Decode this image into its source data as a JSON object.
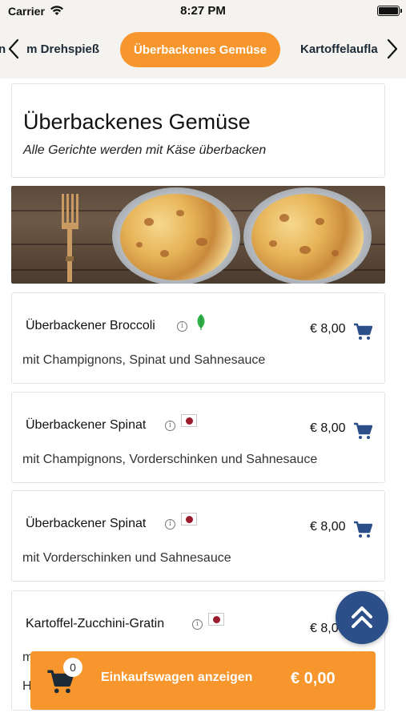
{
  "status_bar": {
    "carrier": "Carrier",
    "time": "8:27 PM"
  },
  "categories": {
    "left": "m Drehspieß",
    "left_prefix": "n",
    "active": "Überbackenes Gemüse",
    "right": "Kartoffelaufla",
    "accent_color": "#f7962d"
  },
  "section": {
    "title": "Überbackenes Gemüse",
    "subtitle": "Alle Gerichte werden mit Käse überbacken"
  },
  "dishes": [
    {
      "name": "Überbackener Broccoli",
      "badge_icon": "leaf-icon",
      "price": "€ 8,00",
      "description": "mit Champignons, Spinat und Sahnesauce"
    },
    {
      "name": "Überbackener Spinat",
      "badge_icon": "pork-icon",
      "price": "€ 8,00",
      "description": "mit Champignons, Vorderschinken und Sahnesauce"
    },
    {
      "name": "Überbackener Spinat",
      "badge_icon": "pork-icon",
      "price": "€ 8,00",
      "description": "mit Vorderschinken und Sahnesauce"
    },
    {
      "name": "Kartoffel-Zucchini-Gratin",
      "badge_icon": "pork-icon",
      "price": "€ 8,0",
      "description": "m",
      "description_line2": "H"
    }
  ],
  "basket": {
    "count": "0",
    "label": "Einkaufswagen anzeigen",
    "total": "€ 0,00",
    "color": "#f7962d"
  },
  "icons": {
    "info": "info-icon",
    "cart": "cart-icon",
    "scroll_top": "double-chevron-up-icon",
    "fab_color": "#2c4f8a"
  }
}
